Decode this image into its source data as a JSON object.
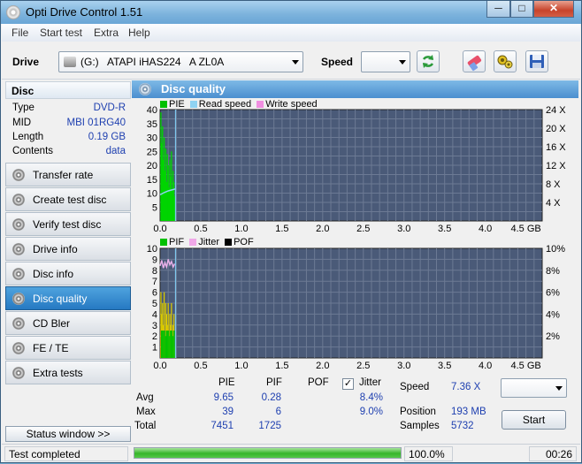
{
  "window": {
    "title": "Opti Drive Control 1.51",
    "min": "─",
    "max": "□",
    "close": "✕"
  },
  "menu": [
    "File",
    "Start test",
    "Extra",
    "Help"
  ],
  "toolbar": {
    "drive_label": "Drive",
    "drive_value": "(G:)   ATAPI iHAS224   A ZL0A",
    "speed_label": "Speed",
    "speed_value": ""
  },
  "disc": {
    "header": "Disc",
    "fields": [
      {
        "key": "Type",
        "value": "DVD-R"
      },
      {
        "key": "MID",
        "value": "MBI 01RG40"
      },
      {
        "key": "Length",
        "value": "0.19 GB"
      },
      {
        "key": "Contents",
        "value": "data"
      }
    ]
  },
  "nav": [
    {
      "label": "Transfer rate",
      "active": false
    },
    {
      "label": "Create test disc",
      "active": false
    },
    {
      "label": "Verify test disc",
      "active": false
    },
    {
      "label": "Drive info",
      "active": false
    },
    {
      "label": "Disc info",
      "active": false
    },
    {
      "label": "Disc quality",
      "active": true
    },
    {
      "label": "CD Bler",
      "active": false
    },
    {
      "label": "FE / TE",
      "active": false
    },
    {
      "label": "Extra tests",
      "active": false
    }
  ],
  "status_window_btn": "Status window >>",
  "panel_title": "Disc quality",
  "chart_data": [
    {
      "type": "line",
      "legend": [
        {
          "name": "PIE",
          "color": "#00c000"
        },
        {
          "name": "Read speed",
          "color": "#8fd3f2"
        },
        {
          "name": "Write speed",
          "color": "#f08ee0"
        }
      ],
      "x_ticks": [
        "0.0",
        "0.5",
        "1.0",
        "1.5",
        "2.0",
        "2.5",
        "3.0",
        "3.5",
        "4.0",
        "4.5 GB"
      ],
      "y_left_ticks": [
        "40",
        "35",
        "30",
        "25",
        "20",
        "15",
        "10",
        "5"
      ],
      "y_right_ticks": [
        "24 X",
        "20 X",
        "16 X",
        "12 X",
        "8 X",
        "4 X"
      ],
      "xlim": [
        0,
        4.7
      ],
      "ylim": [
        0,
        40
      ],
      "disc_end_gb": 0.19,
      "series": [
        {
          "name": "PIE",
          "x": [
            0.01,
            0.02,
            0.03,
            0.04,
            0.05,
            0.06,
            0.07,
            0.08,
            0.09,
            0.1,
            0.11,
            0.12,
            0.13,
            0.14,
            0.15,
            0.16,
            0.17,
            0.18
          ],
          "values": [
            39,
            28,
            34,
            22,
            30,
            18,
            26,
            14,
            24,
            20,
            12,
            22,
            16,
            25,
            11,
            18,
            14,
            9
          ]
        },
        {
          "name": "Read speed",
          "x": [
            0.0,
            0.05,
            0.1,
            0.15,
            0.19
          ],
          "values": [
            9.4,
            10.2,
            10.8,
            11.2,
            11.5
          ]
        }
      ]
    },
    {
      "type": "line",
      "legend": [
        {
          "name": "PIF",
          "color": "#00c000"
        },
        {
          "name": "Jitter",
          "color": "#f0a8e8"
        },
        {
          "name": "POF",
          "color": "#000000"
        }
      ],
      "x_ticks": [
        "0.0",
        "0.5",
        "1.0",
        "1.5",
        "2.0",
        "2.5",
        "3.0",
        "3.5",
        "4.0",
        "4.5 GB"
      ],
      "y_left_ticks": [
        "10",
        "9",
        "8",
        "7",
        "6",
        "5",
        "4",
        "3",
        "2",
        "1"
      ],
      "y_right_ticks": [
        "10%",
        "8%",
        "6%",
        "4%",
        "2%"
      ],
      "xlim": [
        0,
        4.7
      ],
      "ylim": [
        0,
        10
      ],
      "series": [
        {
          "name": "PIF",
          "x": [
            0.01,
            0.02,
            0.03,
            0.04,
            0.05,
            0.06,
            0.07,
            0.08,
            0.09,
            0.1,
            0.11,
            0.12,
            0.13,
            0.14,
            0.15,
            0.16,
            0.17,
            0.18
          ],
          "values": [
            6,
            4,
            5,
            3,
            6,
            2,
            5,
            4,
            3,
            5,
            2,
            4,
            3,
            5,
            2,
            3,
            4,
            1
          ]
        },
        {
          "name": "Jitter",
          "x": [
            0.0,
            0.02,
            0.04,
            0.06,
            0.08,
            0.1,
            0.12,
            0.14,
            0.16,
            0.18
          ],
          "values": [
            8.4,
            8.9,
            8.2,
            8.7,
            8.3,
            9.0,
            8.5,
            8.8,
            8.3,
            8.6
          ]
        }
      ]
    }
  ],
  "stats": {
    "headers": [
      "PIE",
      "PIF",
      "POF",
      "Jitter"
    ],
    "rows": [
      {
        "label": "Avg",
        "pie": "9.65",
        "pif": "0.28",
        "jitter": "8.4%"
      },
      {
        "label": "Max",
        "pie": "39",
        "pif": "6",
        "jitter": "9.0%"
      },
      {
        "label": "Total",
        "pie": "7451",
        "pif": "1725",
        "jitter": ""
      }
    ],
    "jitter_checked": "✓",
    "speed_label": "Speed",
    "speed_value": "7.36 X",
    "position_label": "Position",
    "position_value": "193 MB",
    "samples_label": "Samples",
    "samples_value": "5732",
    "start_button": "Start"
  },
  "statusbar": {
    "text": "Test completed",
    "progress": 1.0,
    "percent": "100.0%",
    "time": "00:26"
  }
}
